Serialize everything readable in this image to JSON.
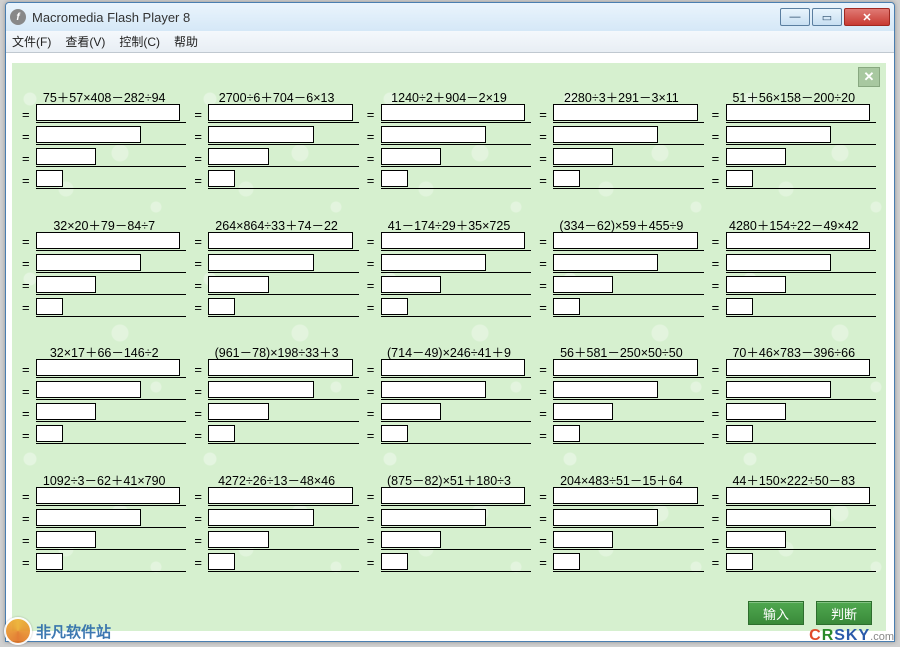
{
  "window": {
    "title": "Macromedia Flash Player 8"
  },
  "menu": {
    "file": "文件(F)",
    "view": "查看(V)",
    "control": "控制(C)",
    "help": "帮助"
  },
  "close_panel_glyph": "✕",
  "buttons": {
    "enter": "输入",
    "judge": "判断"
  },
  "problems": [
    {
      "expr": "75＋57×408－282÷94"
    },
    {
      "expr": "2700÷6＋704－6×13"
    },
    {
      "expr": "1240÷2＋904－2×19"
    },
    {
      "expr": "2280÷3＋291－3×11"
    },
    {
      "expr": "51＋56×158－200÷20"
    },
    {
      "expr": "32×20＋79－84÷7"
    },
    {
      "expr": "264×864÷33＋74－22"
    },
    {
      "expr": "41－174÷29＋35×725"
    },
    {
      "expr": "(334－62)×59＋455÷9"
    },
    {
      "expr": "4280＋154÷22－49×42"
    },
    {
      "expr": "32×17＋66－146÷2"
    },
    {
      "expr": "(961－78)×198÷33＋3"
    },
    {
      "expr": "(714－49)×246÷41＋9"
    },
    {
      "expr": "56＋581－250×50÷50"
    },
    {
      "expr": "70＋46×783－396÷66"
    },
    {
      "expr": "1092÷3－62＋41×790"
    },
    {
      "expr": "4272÷26÷13－48×46"
    },
    {
      "expr": "(875－82)×51＋180÷3"
    },
    {
      "expr": "204×483÷51－15＋64"
    },
    {
      "expr": "44＋150×222÷50－83"
    }
  ],
  "eq": "=",
  "watermark": {
    "left": "非凡软件站",
    "right_c": "C",
    "right_r": "R",
    "right_sky": "SKY",
    "right_dom": ".com"
  }
}
